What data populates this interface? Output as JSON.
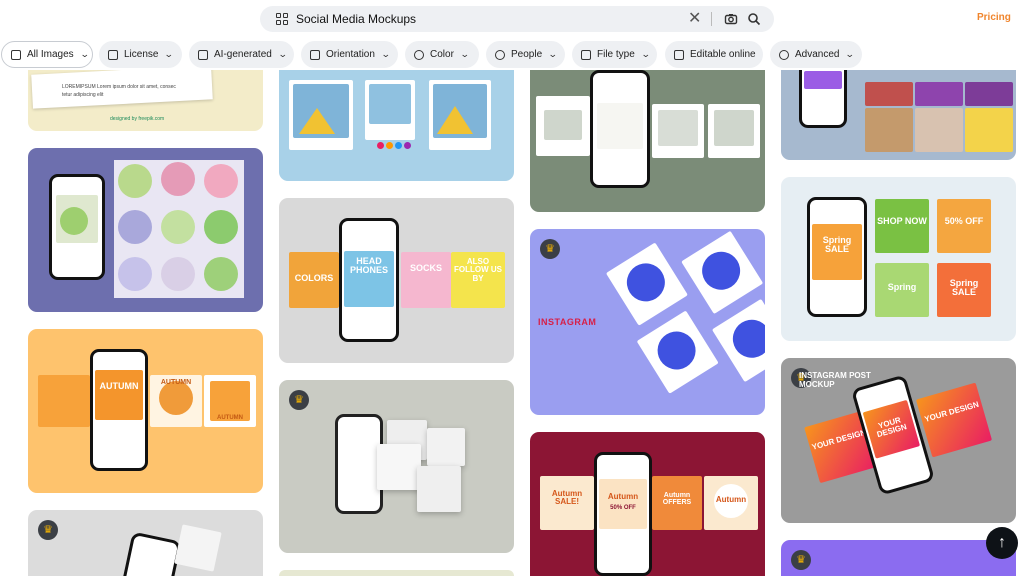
{
  "search": {
    "value": "Social Media Mockups",
    "clear_icon": "close-icon",
    "camera_icon": "camera-icon",
    "search_icon": "search-icon"
  },
  "header": {
    "pricing_label": "Pricing"
  },
  "filters": [
    {
      "label": "All Images",
      "icon": "grid-icon"
    },
    {
      "label": "License",
      "icon": "document-icon"
    },
    {
      "label": "AI-generated",
      "icon": "ai-icon"
    },
    {
      "label": "Orientation",
      "icon": "orientation-icon"
    },
    {
      "label": "Color",
      "icon": "palette-icon"
    },
    {
      "label": "People",
      "icon": "people-icon"
    },
    {
      "label": "File type",
      "icon": "file-icon"
    },
    {
      "label": "Editable online",
      "icon": "edit-icon"
    },
    {
      "label": "Advanced",
      "icon": "gear-icon"
    }
  ],
  "cards": {
    "c1": {
      "text1": "LOREMIPSUM  Lorem ipsum dolor sit amet, consec",
      "text2": "tetur adipiscing elit",
      "credit": "designed by freepik.com"
    },
    "c5": {
      "words": [
        "HEAD PHONES",
        "COLORS",
        "SOCKS",
        "ALSO FOLLOW US BY"
      ]
    },
    "c6": {
      "title": "INSTAGRAM"
    },
    "c7": {
      "words": [
        "AUTUMN",
        "AUTUMN",
        "AUTUMN"
      ]
    },
    "c9": {
      "words": [
        "Autumn SALE!",
        "Autumn",
        "50% OFF",
        "Autumn OFFERS",
        "Autumn"
      ]
    },
    "c10": {
      "words": [
        "Spring SALE",
        "SHOP NOW",
        "50% OFF",
        "Spring",
        "Spring SALE"
      ]
    },
    "c11": {
      "title": "INSTAGRAM POST MOCKUP",
      "words": [
        "YOUR DESIGN",
        "YOUR DESIGN",
        "YOUR DESIGN"
      ]
    }
  },
  "colors": {
    "accent": "#f0852d",
    "chip_bg": "#eef0f3",
    "crown": "#f5b400"
  }
}
